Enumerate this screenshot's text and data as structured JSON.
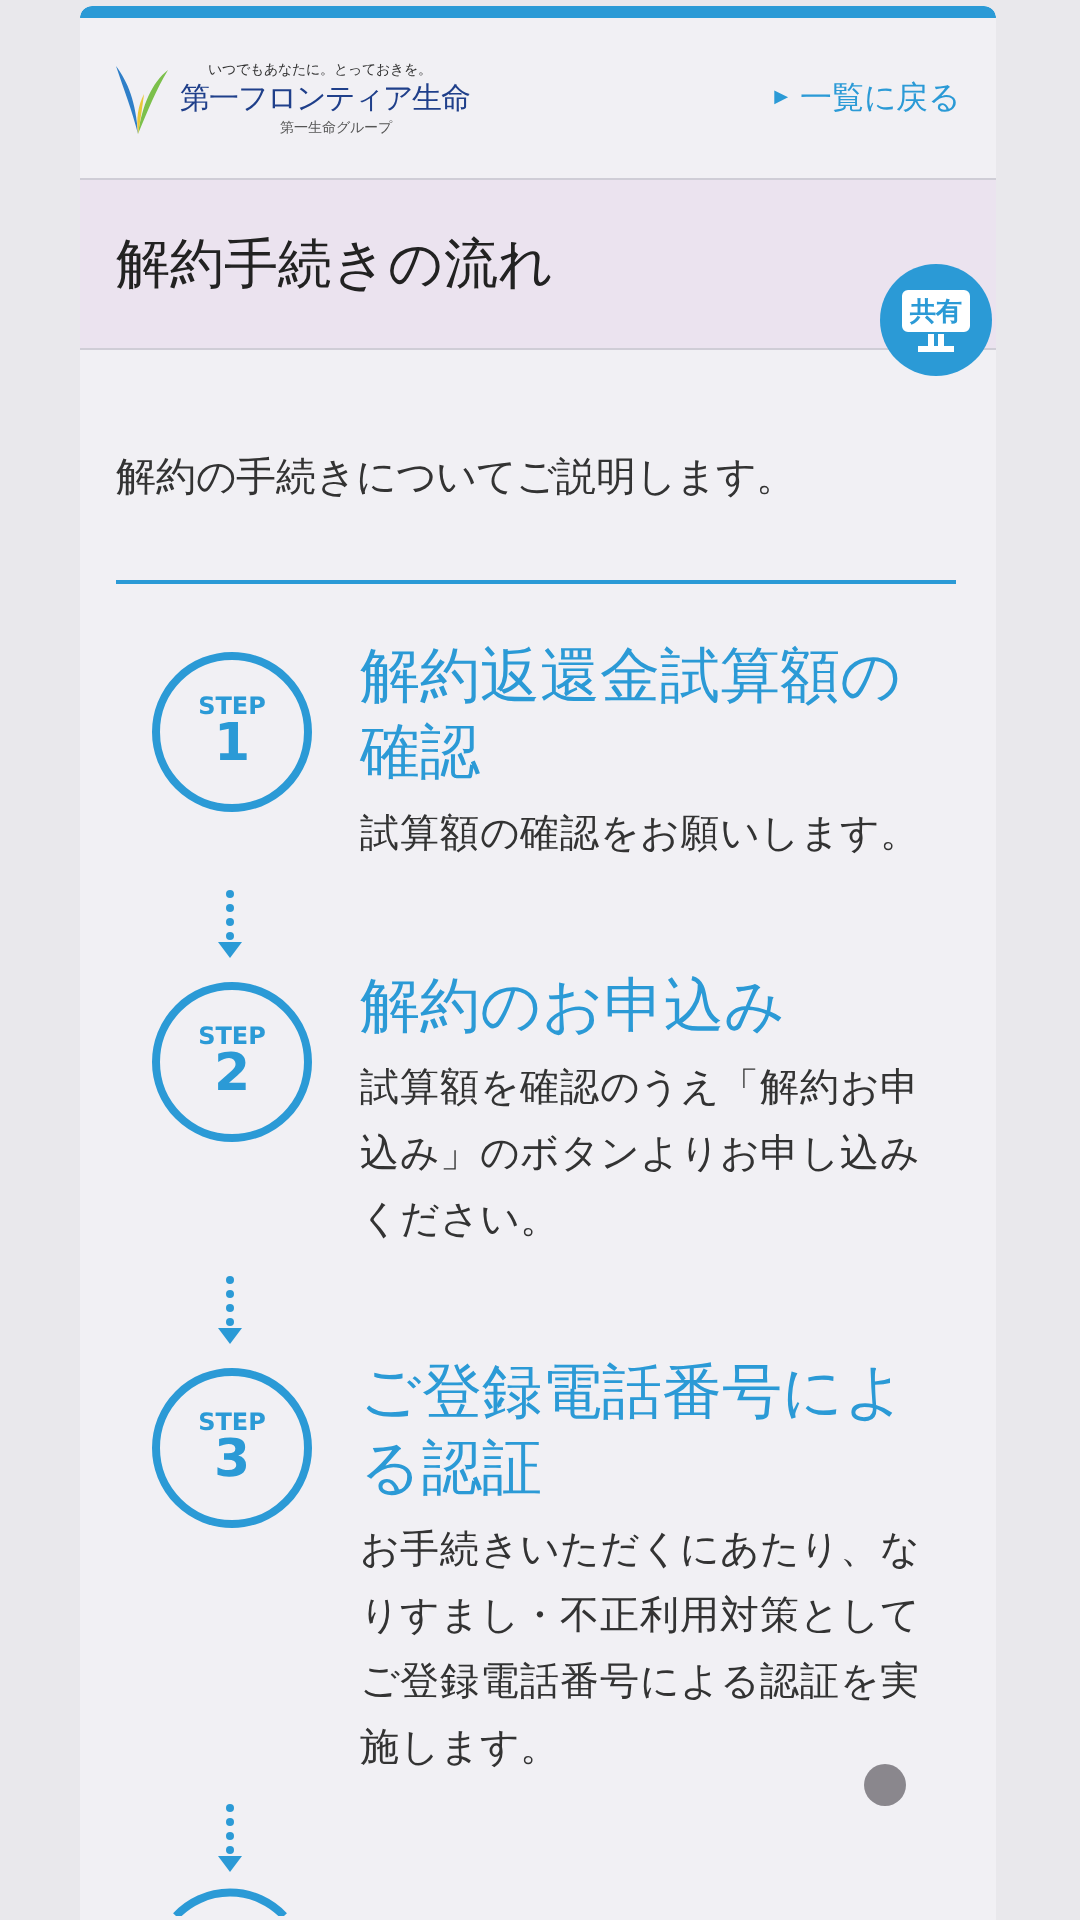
{
  "header": {
    "logo": {
      "tagline": "いつでもあなたに。とっておきを。",
      "name": "第一フロンティア生命",
      "group": "第一生命グループ"
    },
    "back_link": {
      "marker": "▶",
      "label": "一覧に戻る"
    }
  },
  "title_band": {
    "title": "解約手続きの流れ",
    "share_label": "共有"
  },
  "intro": "解約の手続きについてご説明します。",
  "steps": [
    {
      "step_label": "STEP",
      "number": "1",
      "title": "解約返還金試算額の確認",
      "description": "試算額の確認をお願いします。"
    },
    {
      "step_label": "STEP",
      "number": "2",
      "title": "解約のお申込み",
      "description": "試算額を確認のうえ「解約お申込み」のボタンよりお申し込みください。"
    },
    {
      "step_label": "STEP",
      "number": "3",
      "title": "ご登録電話番号による認証",
      "description": "お手続きいただくにあたり、なりすまし・不正利用対策としてご登録電話番号による認証を実施します。"
    }
  ],
  "next_step_cut_off": true
}
